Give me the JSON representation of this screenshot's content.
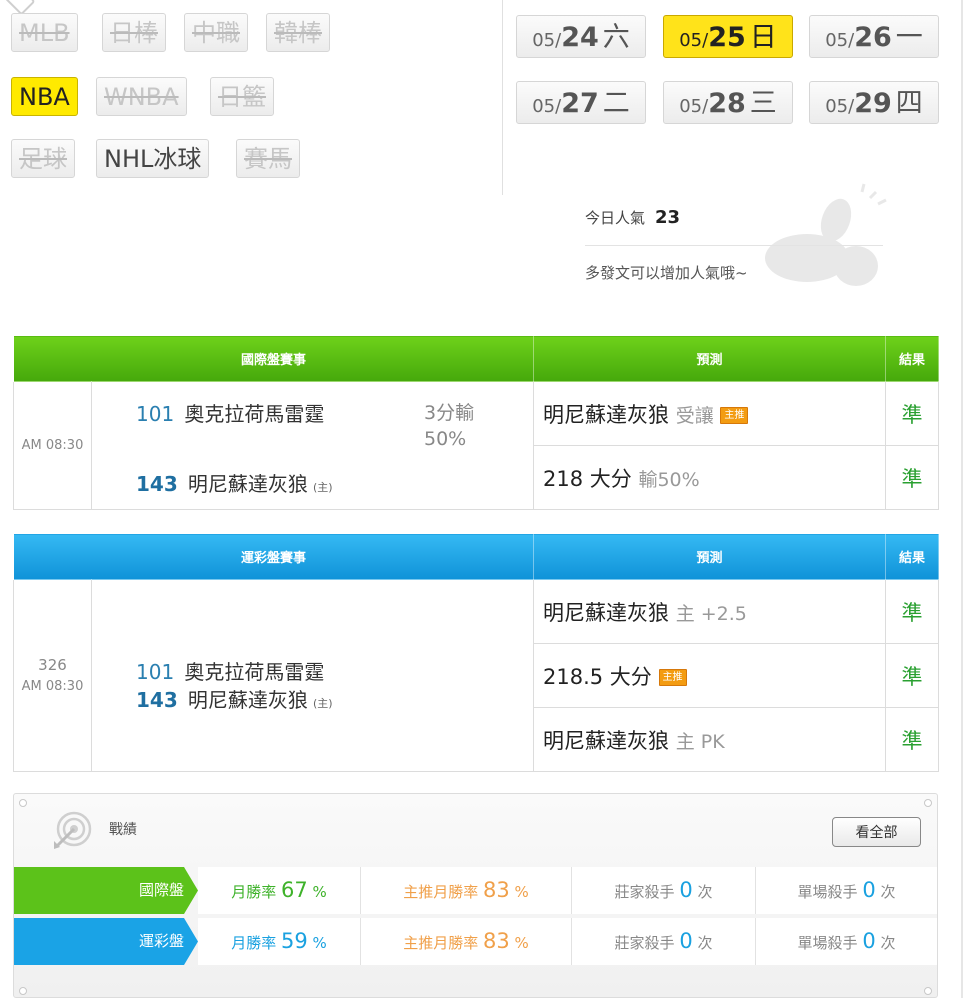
{
  "leagues": [
    {
      "label": "MLB",
      "state": "disabled"
    },
    {
      "label": "日棒",
      "state": "disabled"
    },
    {
      "label": "中職",
      "state": "disabled"
    },
    {
      "label": "韓棒",
      "state": "disabled"
    },
    {
      "label": "NBA",
      "state": "selected"
    },
    {
      "label": "WNBA",
      "state": "disabled"
    },
    {
      "label": "日籃",
      "state": "disabled"
    },
    {
      "label": "足球",
      "state": "disabled"
    },
    {
      "label": "NHL冰球",
      "state": "active"
    },
    {
      "label": "賽馬",
      "state": "disabled"
    }
  ],
  "dates": [
    {
      "md": "05/",
      "day": "24",
      "wd": "六",
      "selected": false
    },
    {
      "md": "05/",
      "day": "25",
      "wd": "日",
      "selected": true
    },
    {
      "md": "05/",
      "day": "26",
      "wd": "一",
      "selected": false
    },
    {
      "md": "05/",
      "day": "27",
      "wd": "二",
      "selected": false
    },
    {
      "md": "05/",
      "day": "28",
      "wd": "三",
      "selected": false
    },
    {
      "md": "05/",
      "day": "29",
      "wd": "四",
      "selected": false
    }
  ],
  "popularity": {
    "label": "今日人氣",
    "value": "23",
    "hint": "多發文可以增加人氣哦~"
  },
  "intl_table": {
    "header": {
      "event": "國際盤賽事",
      "prediction": "預測",
      "result": "結果"
    },
    "time": "AM 08:30",
    "away": {
      "code": "101",
      "name": "奧克拉荷馬雷霆"
    },
    "home": {
      "code": "143",
      "name": "明尼蘇達灰狼",
      "tag": "(主)"
    },
    "line": "3分輸",
    "line_pct": "50%",
    "predictions": [
      {
        "main": "明尼蘇達灰狼",
        "sub": "受讓",
        "badge": "主推",
        "result": "準"
      },
      {
        "main": "218 大分",
        "sub": "輸50%",
        "badge": "",
        "result": "準"
      }
    ]
  },
  "lottery_table": {
    "header": {
      "event": "運彩盤賽事",
      "prediction": "預測",
      "result": "結果"
    },
    "game_no": "326",
    "time": "AM 08:30",
    "away": {
      "code": "101",
      "name": "奧克拉荷馬雷霆"
    },
    "home": {
      "code": "143",
      "name": "明尼蘇達灰狼",
      "tag": "(主)"
    },
    "predictions": [
      {
        "main": "明尼蘇達灰狼",
        "sub": "主 +2.5",
        "badge": "",
        "result": "準"
      },
      {
        "main": "218.5 大分",
        "sub": "",
        "badge": "主推",
        "result": "準"
      },
      {
        "main": "明尼蘇達灰狼",
        "sub": "主 PK",
        "badge": "",
        "result": "準"
      }
    ]
  },
  "record": {
    "title": "戰績",
    "view_all": "看全部",
    "rows": [
      {
        "category": "國際盤",
        "color": "#5cc21a",
        "month_label": "月勝率",
        "month_value": "67",
        "month_unit": "%",
        "top_label": "主推月勝率",
        "top_value": "83",
        "top_unit": "%",
        "killer_label": "莊家殺手",
        "killer_value": "0",
        "killer_unit": "次",
        "single_label": "單場殺手",
        "single_value": "0",
        "single_unit": "次"
      },
      {
        "category": "運彩盤",
        "color": "#1aa3e6",
        "month_label": "月勝率",
        "month_value": "59",
        "month_unit": "%",
        "top_label": "主推月勝率",
        "top_value": "83",
        "top_unit": "%",
        "killer_label": "莊家殺手",
        "killer_value": "0",
        "killer_unit": "次",
        "single_label": "單場殺手",
        "single_value": "0",
        "single_unit": "次"
      }
    ]
  }
}
